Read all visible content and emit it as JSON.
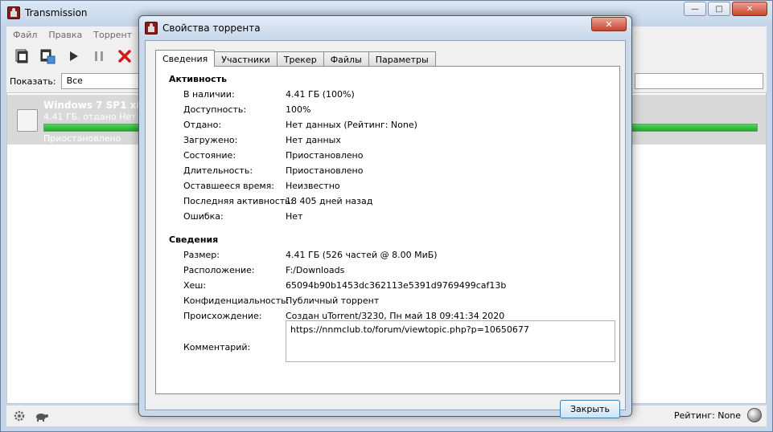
{
  "main_window": {
    "title": "Transmission",
    "controls": {
      "minimize": "—",
      "maximize": "□",
      "close": "✕"
    },
    "menu": [
      "Файл",
      "Правка",
      "Торрент"
    ],
    "filter_label": "Показать:",
    "filter_value": "Все",
    "torrent": {
      "name": "Windows 7 SP1 x86-",
      "info": "4.41 ГБ, отдано Нет д",
      "status": "Приостановлено",
      "progress_fraction": 1.0
    },
    "status_rating": "Рейтинг: None"
  },
  "dialog": {
    "title": "Свойства торрента",
    "close_glyph": "✕",
    "tabs": [
      "Сведения",
      "Участники",
      "Трекер",
      "Файлы",
      "Параметры"
    ],
    "active_tab": 0,
    "activity": {
      "heading": "Активность",
      "rows": [
        {
          "label": "В наличии:",
          "value": "4.41 ГБ (100%)"
        },
        {
          "label": "Доступность:",
          "value": "100%"
        },
        {
          "label": "Отдано:",
          "value": "Нет данных (Рейтинг: None)"
        },
        {
          "label": "Загружено:",
          "value": "Нет данных"
        },
        {
          "label": "Состояние:",
          "value": "Приостановлено"
        },
        {
          "label": "Длительность:",
          "value": "Приостановлено"
        },
        {
          "label": "Оставшееся время:",
          "value": "Неизвестно"
        },
        {
          "label": "Последняя активность:",
          "value": "18 405 дней назад"
        },
        {
          "label": "Ошибка:",
          "value": "Нет"
        }
      ]
    },
    "details": {
      "heading": "Сведения",
      "rows": [
        {
          "label": "Размер:",
          "value": "4.41 ГБ (526 частей @ 8.00 МиБ)"
        },
        {
          "label": "Расположение:",
          "value": "F:/Downloads"
        },
        {
          "label": "Хеш:",
          "value": "65094b90b1453dc362113e5391d9769499caf13b"
        },
        {
          "label": "Конфиденциальность:",
          "value": "Публичный торрент"
        },
        {
          "label": "Происхождение:",
          "value": "Создан uTorrent/3230, Пн май 18 09:41:34 2020"
        }
      ],
      "comment_label": "Комментарий:",
      "comment_value": "https://nnmclub.to/forum/viewtopic.php?p=10650677"
    },
    "close_button": "Закрыть"
  }
}
